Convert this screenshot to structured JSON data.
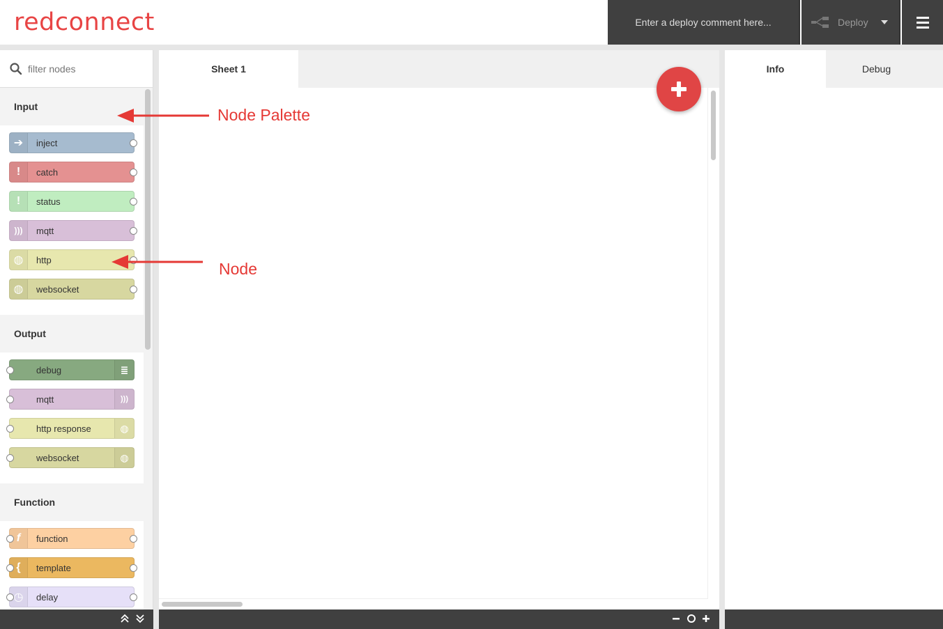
{
  "header": {
    "logo_prefix": "red",
    "logo_suffix": "connect",
    "deploy_comment_placeholder": "Enter a deploy comment here...",
    "deploy_label": "Deploy"
  },
  "palette": {
    "search_placeholder": "filter nodes",
    "categories": [
      {
        "name": "Input",
        "nodes": [
          {
            "label": "inject",
            "color": "#a6bbcf"
          },
          {
            "label": "catch",
            "color": "#e49191"
          },
          {
            "label": "status",
            "color": "#c0edc0"
          },
          {
            "label": "mqtt",
            "color": "#d8bfd8"
          },
          {
            "label": "http",
            "color": "#e7e7ae"
          },
          {
            "label": "websocket",
            "color": "#d7d7a0"
          }
        ]
      },
      {
        "name": "Output",
        "nodes": [
          {
            "label": "debug",
            "color": "#87a980"
          },
          {
            "label": "mqtt",
            "color": "#d8bfd8"
          },
          {
            "label": "http response",
            "color": "#e7e7ae"
          },
          {
            "label": "websocket",
            "color": "#d7d7a0"
          }
        ]
      },
      {
        "name": "Function",
        "nodes": [
          {
            "label": "function",
            "color": "#fdd0a2"
          },
          {
            "label": "template",
            "color": "#ebb860"
          },
          {
            "label": "delay",
            "color": "#e6e0f8"
          }
        ]
      }
    ]
  },
  "workspace": {
    "tab_label": "Sheet 1"
  },
  "sidebar": {
    "tab_info": "Info",
    "tab_debug": "Debug"
  },
  "annotations": {
    "palette_label": "Node Palette",
    "node_label": "Node",
    "color": "#e53935"
  }
}
